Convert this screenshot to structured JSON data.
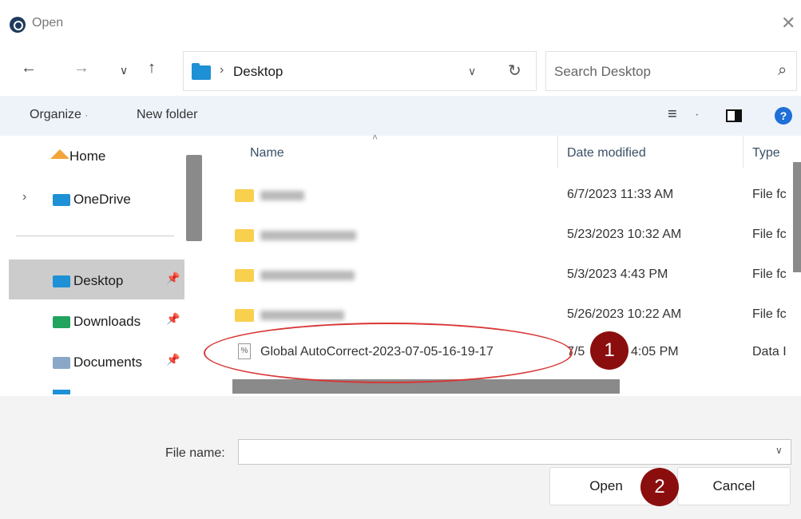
{
  "window": {
    "title": "Open"
  },
  "nav": {
    "back_icon": "←",
    "forward_icon": "→",
    "recent_icon": "∨",
    "up_icon": "↑",
    "address_separator": "›",
    "address_location": "Desktop",
    "address_dropdown_icon": "∨",
    "refresh_icon": "↻",
    "search_placeholder": "Search Desktop",
    "search_icon": "⌕"
  },
  "commands": {
    "organize": "Organize",
    "organize_dot": "·",
    "new_folder": "New folder",
    "view_icon": "≡",
    "view_dot": "·",
    "help_icon": "?"
  },
  "sidebar": {
    "items": [
      {
        "label": "Home"
      },
      {
        "label": "OneDrive"
      },
      {
        "label": "Desktop"
      },
      {
        "label": "Downloads"
      },
      {
        "label": "Documents"
      }
    ],
    "expand_icon": "›",
    "pin_icon": "📌"
  },
  "list": {
    "columns": [
      "Name",
      "Date modified",
      "Type"
    ],
    "sort_icon": "˄",
    "rows": [
      {
        "name": "",
        "date": "6/7/2023 11:33 AM",
        "type": "File fc"
      },
      {
        "name": "",
        "date": "5/23/2023 10:32 AM",
        "type": "File fc"
      },
      {
        "name": "",
        "date": "5/3/2023 4:43 PM",
        "type": "File fc"
      },
      {
        "name": "",
        "date": "5/26/2023 10:22 AM",
        "type": "File fc"
      },
      {
        "name": "Global AutoCorrect-2023-07-05-16-19-17",
        "date_prefix": "7/5",
        "date": "4:05 PM",
        "type": "Data I"
      }
    ]
  },
  "bottom": {
    "file_name_label": "File name:",
    "file_name_value": "",
    "dropdown_icon": "∨",
    "open_label": "Open",
    "cancel_label": "Cancel"
  },
  "annotations": {
    "badge1": "1",
    "badge2": "2"
  },
  "colors": {
    "annotation_red": "#d93737",
    "badge": "#8b0e0e",
    "selected": "#cccccc",
    "command_bar": "#eef3fa"
  }
}
